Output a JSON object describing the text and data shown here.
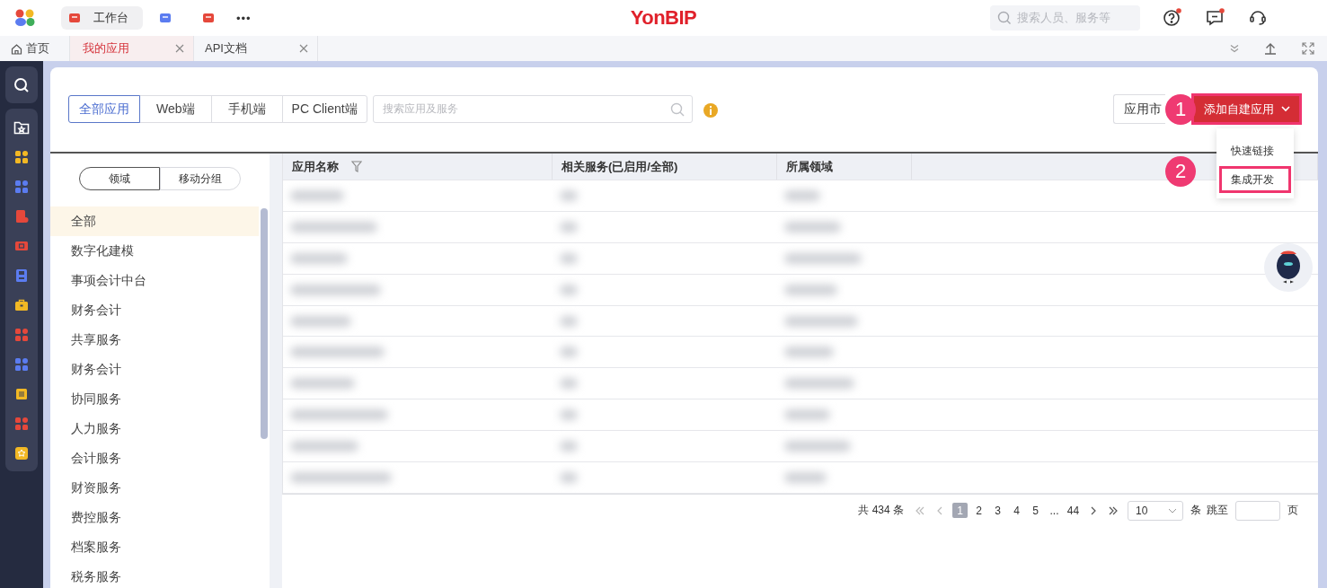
{
  "top_bar": {
    "apps": [
      {
        "label": "工作台",
        "color": "#e5483b",
        "selected": true
      },
      {
        "color": "#5b7cf0",
        "selected": false
      },
      {
        "color": "#e5483b",
        "selected": false
      }
    ],
    "more": "•••",
    "logo": "YonBIP",
    "search": {
      "placeholder": "搜索人员、服务等"
    },
    "actions": [
      {
        "kind": "help",
        "badge": true
      },
      {
        "kind": "message",
        "badge": true
      },
      {
        "kind": "support",
        "badge": false
      }
    ]
  },
  "tabs": [
    {
      "label": "首页",
      "kind": "home",
      "selected": false
    },
    {
      "label": "我的应用",
      "kind": "closable",
      "selected": true
    },
    {
      "label": "API文档",
      "kind": "closable",
      "selected": false
    }
  ],
  "side_nav": [
    {
      "kind": "search",
      "color": "#ffffff"
    },
    {
      "kind": "folder",
      "color": "#ffffff"
    },
    {
      "kind": "grid",
      "color": "#f2b824"
    },
    {
      "kind": "grid",
      "color": "#5b7cf0"
    },
    {
      "kind": "doc",
      "color": "#e5483b"
    },
    {
      "kind": "ticket",
      "color": "#e5483b"
    },
    {
      "kind": "disk",
      "color": "#5b7cf0"
    },
    {
      "kind": "briefcase",
      "color": "#f2b824"
    },
    {
      "kind": "grid",
      "color": "#e5483b"
    },
    {
      "kind": "grid",
      "color": "#5b7cf0"
    },
    {
      "kind": "book",
      "color": "#f2b824"
    },
    {
      "kind": "grid",
      "color": "#e5483b"
    },
    {
      "kind": "star",
      "color": "#f2b824"
    }
  ],
  "filters": [
    {
      "label": "全部应用",
      "selected": true
    },
    {
      "label": "Web端",
      "selected": false
    },
    {
      "label": "手机端",
      "selected": false
    },
    {
      "label": "PC Client端",
      "selected": false
    }
  ],
  "app_search": {
    "placeholder": "搜索应用及服务"
  },
  "market_button": "应用市",
  "add_button": "添加自建应用",
  "add_menu": [
    {
      "label": "快速链接",
      "highlighted": false
    },
    {
      "label": "集成开发",
      "highlighted": true
    }
  ],
  "steps": [
    "1",
    "2"
  ],
  "group_toggle": [
    {
      "label": "领域",
      "selected": true
    },
    {
      "label": "移动分组",
      "selected": false
    }
  ],
  "domains": [
    {
      "label": "全部",
      "selected": true
    },
    {
      "label": "数字化建模",
      "selected": false
    },
    {
      "label": "事项会计中台",
      "selected": false
    },
    {
      "label": "财务会计",
      "selected": false
    },
    {
      "label": "共享服务",
      "selected": false
    },
    {
      "label": "财务会计",
      "selected": false
    },
    {
      "label": "协同服务",
      "selected": false
    },
    {
      "label": "人力服务",
      "selected": false
    },
    {
      "label": "会计服务",
      "selected": false
    },
    {
      "label": "财资服务",
      "selected": false
    },
    {
      "label": "费控服务",
      "selected": false
    },
    {
      "label": "档案服务",
      "selected": false
    },
    {
      "label": "税务服务",
      "selected": false
    }
  ],
  "table": {
    "columns": [
      {
        "label": "应用名称",
        "filter": true
      },
      {
        "label": "相关服务(已启用/全部)",
        "filter": false
      },
      {
        "label": "所属领域",
        "filter": false
      }
    ]
  },
  "pagination": {
    "total": "共 434 条",
    "pages": [
      {
        "label": "1",
        "selected": true
      },
      {
        "label": "2",
        "selected": false
      },
      {
        "label": "3",
        "selected": false
      },
      {
        "label": "4",
        "selected": false
      },
      {
        "label": "5",
        "selected": false
      },
      {
        "label": "...",
        "selected": false
      },
      {
        "label": "44",
        "selected": false
      }
    ],
    "page_size": "10",
    "unit": "条",
    "jump_label": "跳至",
    "page_label": "页"
  }
}
